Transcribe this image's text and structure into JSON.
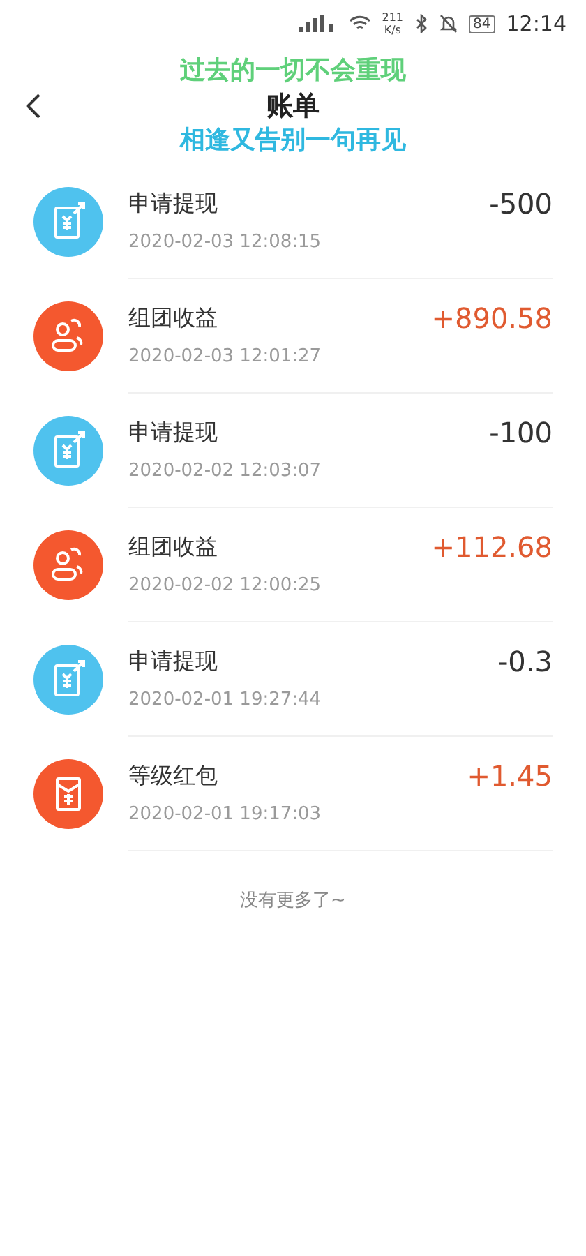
{
  "status_bar": {
    "speed": "211",
    "speed_unit": "K/s",
    "battery": "84",
    "time": "12:14"
  },
  "header": {
    "title": "账单"
  },
  "floating_lyrics": [
    "过去的一切不会重现",
    "相逢又告别一句再见"
  ],
  "records": [
    {
      "kind": "withdraw",
      "title": "申请提现",
      "time": "2020-02-03 12:08:15",
      "amount": "-500"
    },
    {
      "kind": "team",
      "title": "组团收益",
      "time": "2020-02-03 12:01:27",
      "amount": "+890.58"
    },
    {
      "kind": "withdraw",
      "title": "申请提现",
      "time": "2020-02-02 12:03:07",
      "amount": "-100"
    },
    {
      "kind": "team",
      "title": "组团收益",
      "time": "2020-02-02 12:00:25",
      "amount": "+112.68"
    },
    {
      "kind": "withdraw",
      "title": "申请提现",
      "time": "2020-02-01 19:27:44",
      "amount": "-0.3"
    },
    {
      "kind": "redpacket",
      "title": "等级红包",
      "time": "2020-02-01 19:17:03",
      "amount": "+1.45"
    }
  ],
  "footer": "没有更多了~"
}
